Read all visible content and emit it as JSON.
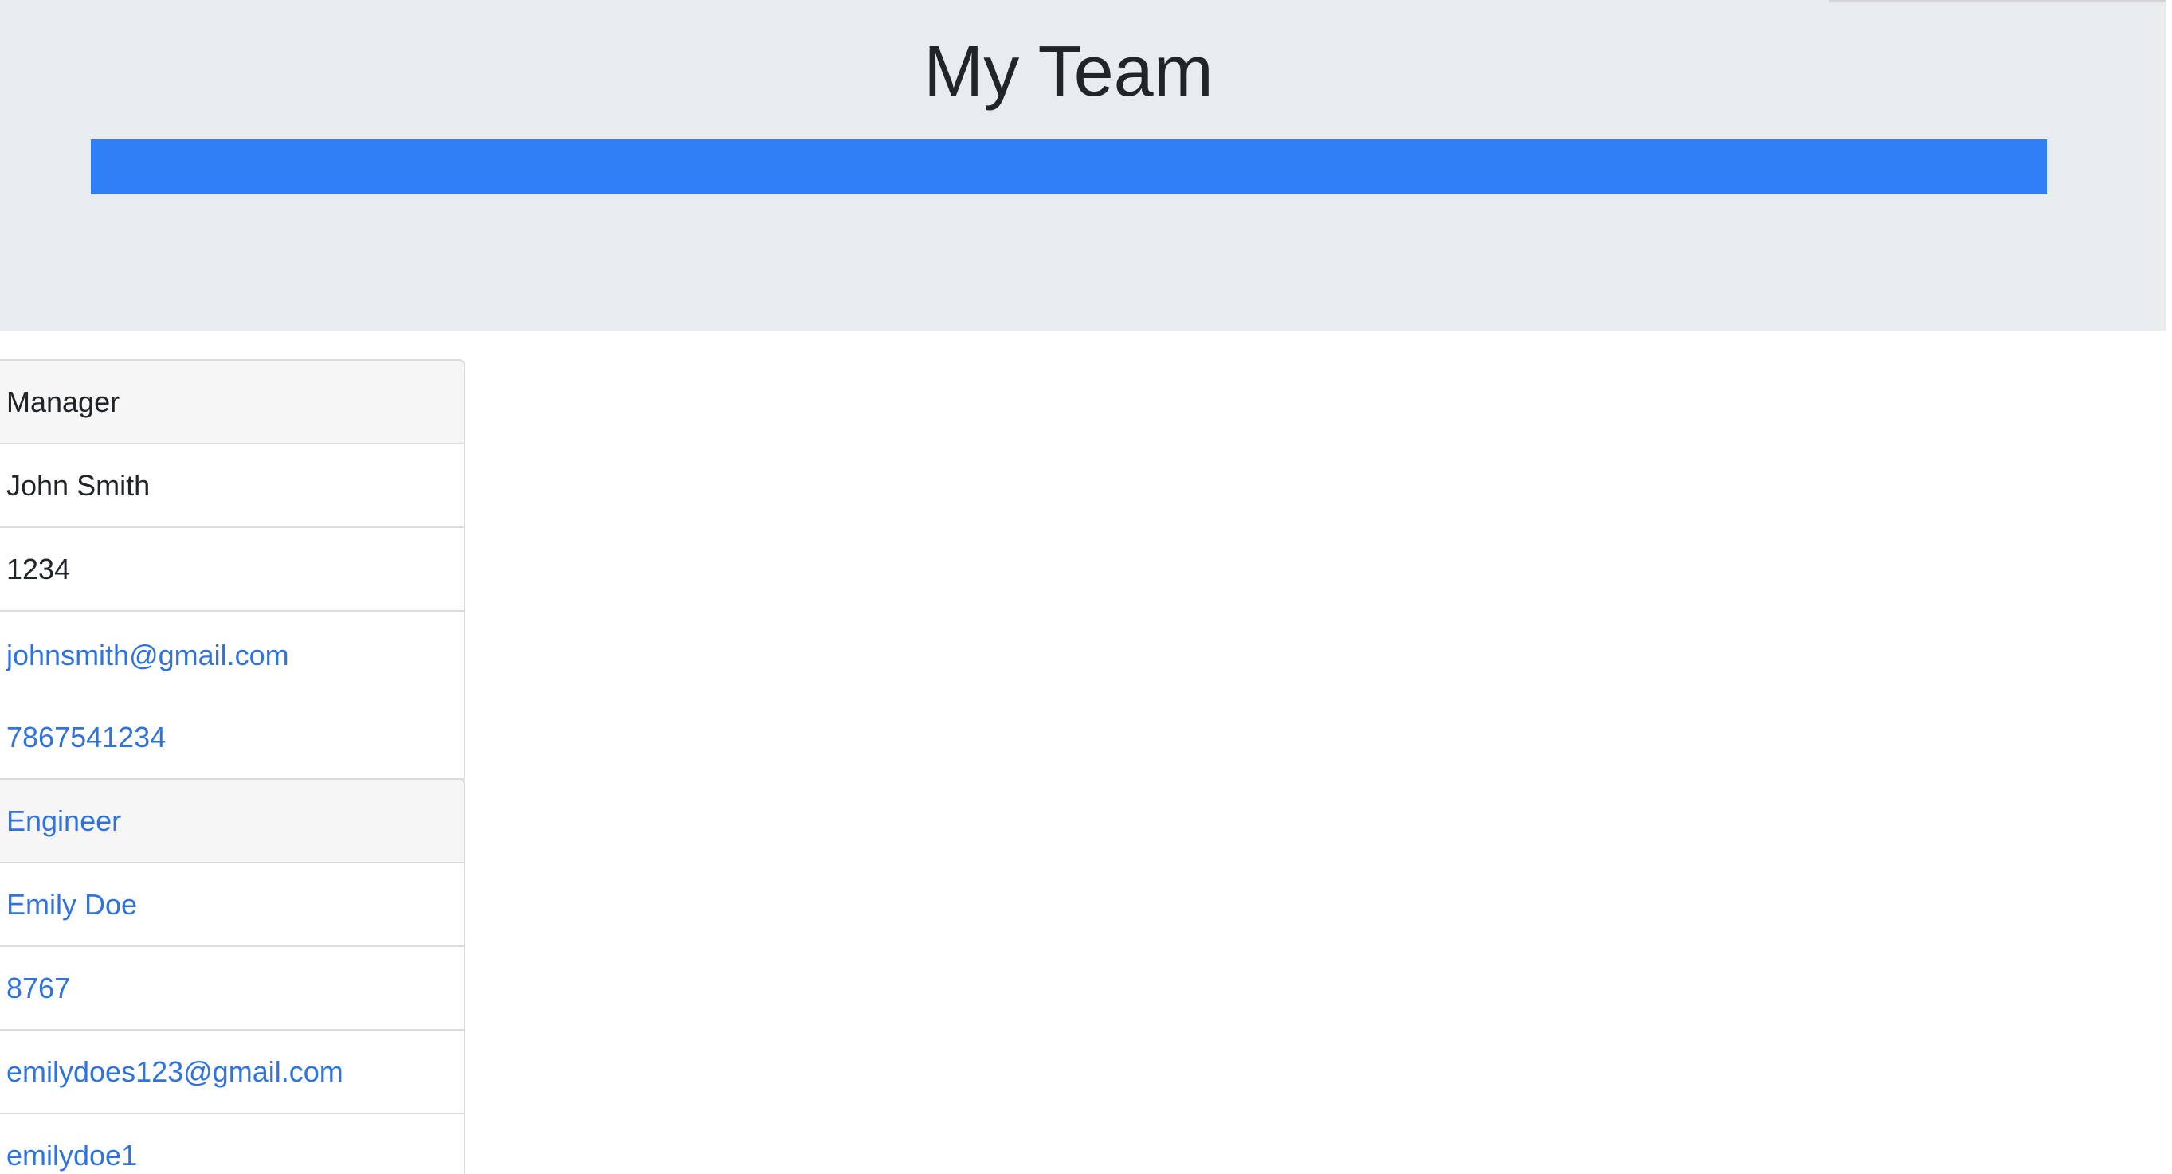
{
  "header": {
    "title": "My Team"
  },
  "colors": {
    "hero_bg": "#e9ecef",
    "accent_bar": "#307ff6",
    "link": "#2f74de"
  },
  "cards": {
    "manager": {
      "role": "Manager",
      "name": "John Smith",
      "id": "1234",
      "email": "johnsmith@gmail.com",
      "phone": "7867541234"
    },
    "engineer": {
      "role": "Engineer",
      "name": "Emily Doe",
      "id": "8767",
      "email": "emilydoes123@gmail.com",
      "github": "emilydoe1"
    }
  }
}
